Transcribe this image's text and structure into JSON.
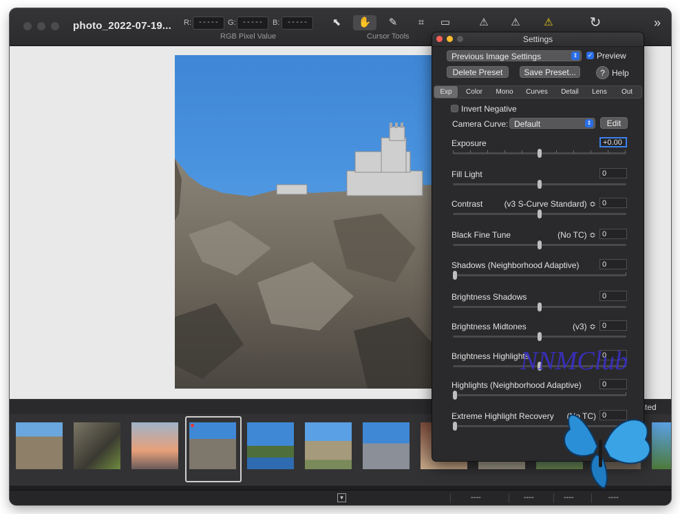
{
  "window": {
    "title": "photo_2022-07-19...",
    "rgb": {
      "r_label": "R:",
      "g_label": "G:",
      "b_label": "B:",
      "r_value": "-----",
      "g_value": "-----",
      "b_value": "-----",
      "caption": "RGB Pixel Value"
    },
    "cursor_tools_caption": "Cursor Tools",
    "tools": [
      {
        "name": "arrow-icon",
        "glyph": "⬉"
      },
      {
        "name": "hand-icon",
        "glyph": "✋"
      },
      {
        "name": "eyedropper-icon",
        "glyph": "✎"
      },
      {
        "name": "crop-icon",
        "glyph": "⌗"
      },
      {
        "name": "white-balance-icon",
        "glyph": "▭"
      },
      {
        "name": "clipping-warning-icon",
        "glyph": "⚠"
      },
      {
        "name": "highlight-warning-icon",
        "glyph": "⚠"
      },
      {
        "name": "shadow-warning-icon",
        "glyph": "⚠"
      },
      {
        "name": "rotate-icon",
        "glyph": "↻"
      },
      {
        "name": "expand-icon",
        "glyph": "»"
      }
    ]
  },
  "filmstrip": {
    "selected_label": "cted",
    "selected_index": 3
  },
  "statusbar": {
    "collapse_glyph": "▾",
    "values": [
      "----",
      "----",
      "----",
      "----"
    ]
  },
  "settings": {
    "title": "Settings",
    "preset_select": "Previous Image Settings",
    "preview_label": "Preview",
    "delete_preset": "Delete Preset",
    "save_preset": "Save Preset...",
    "help_glyph": "?",
    "help_label": "Help",
    "tabs": [
      "Exp",
      "Color",
      "Mono",
      "Curves",
      "Detail",
      "Lens",
      "Out"
    ],
    "invert_negative": "Invert Negative",
    "camera_curve_label": "Camera Curve:",
    "camera_curve_value": "Default",
    "edit_button": "Edit",
    "rows": [
      {
        "label": "Exposure",
        "mode": "",
        "value": "+0.00",
        "knob": 0.5
      },
      {
        "label": "Fill Light",
        "mode": "",
        "value": "0",
        "knob": 0.5
      },
      {
        "label": "Contrast",
        "mode": "(v3 S-Curve Standard) ≎",
        "value": "0",
        "knob": 0.5
      },
      {
        "label": "Black Fine Tune",
        "mode": "(No TC) ≎",
        "value": "0",
        "knob": 0.5
      },
      {
        "label": "Shadows (Neighborhood Adaptive)",
        "mode": "",
        "value": "0",
        "knob": 0.0
      },
      {
        "label": "Brightness Shadows",
        "mode": "",
        "value": "0",
        "knob": 0.5
      },
      {
        "label": "Brightness Midtones",
        "mode": "(v3) ≎",
        "value": "0",
        "knob": 0.5
      },
      {
        "label": "Brightness Highlights",
        "mode": "",
        "value": "0",
        "knob": 0.5
      },
      {
        "label": "Highlights (Neighborhood Adaptive)",
        "mode": "",
        "value": "0",
        "knob": 0.0
      },
      {
        "label": "Extreme Highlight Recovery",
        "mode": "(No TC)",
        "value": "0",
        "knob": 0.0
      }
    ]
  },
  "watermark": "NNMClub",
  "colors": {
    "accent": "#2a6ee6",
    "window_bg": "#1f1f21",
    "panel_bg": "#2a2a2c"
  }
}
